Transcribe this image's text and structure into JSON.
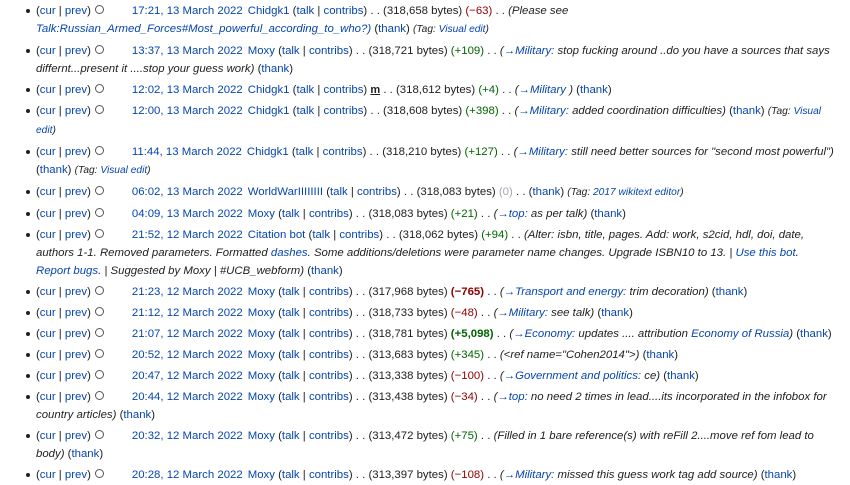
{
  "links": {
    "cur": "cur",
    "prev": "prev",
    "talk": "talk",
    "contribs": "contribs",
    "thank": "thank"
  },
  "entries": [
    {
      "date": "17:21, 13 March 2022",
      "user": "Chidgk1",
      "minor": "",
      "size": "(318,658 bytes)",
      "diff": "(−63)",
      "diff_class": "neg-small",
      "comment_pre": "(Please see",
      "comment_section": "",
      "comment_body": "",
      "comment_line2": "Talk:Russian_Armed_Forces#Most_powerful_according_to_who?)",
      "comment_post": "",
      "tags_label": "Tag:",
      "tags": "Visual edit"
    },
    {
      "date": "13:37, 13 March 2022",
      "user": "Moxy",
      "minor": "",
      "size": "(318,721 bytes)",
      "diff": "(+109)",
      "diff_class": "pos-small",
      "comment_pre": "(",
      "comment_section": "→Military:",
      "comment_body": "stop fucking around ..do you have a sources that says differnt...present it ....stop your guess work)",
      "comment_line2": "",
      "comment_post": "",
      "tags_label": "",
      "tags": ""
    },
    {
      "date": "12:02, 13 March 2022",
      "user": "Chidgk1",
      "minor": "m",
      "size": "(318,612 bytes)",
      "diff": "(+4)",
      "diff_class": "pos-small",
      "comment_pre": "(",
      "comment_section": "→Military",
      "comment_body": ")",
      "comment_line2": "",
      "comment_post": "",
      "tags_label": "",
      "tags": ""
    },
    {
      "date": "12:00, 13 March 2022",
      "user": "Chidgk1",
      "minor": "",
      "size": "(318,608 bytes)",
      "diff": "(+398)",
      "diff_class": "pos-small",
      "comment_pre": "(",
      "comment_section": "→Military:",
      "comment_body": "added coordination difficulties)",
      "comment_line2": "",
      "comment_post": "",
      "tags_label": "Tag:",
      "tags": "Visual edit"
    },
    {
      "date": "11:44, 13 March 2022",
      "user": "Chidgk1",
      "minor": "",
      "size": "(318,210 bytes)",
      "diff": "(+127)",
      "diff_class": "pos-small",
      "comment_pre": "(",
      "comment_section": "→Military:",
      "comment_body": "still need better sources for \"second most powerful\")",
      "comment_line2": "",
      "comment_post": "",
      "tags_label": "Tag:",
      "tags": "Visual edit"
    },
    {
      "date": "06:02, 13 March 2022",
      "user": "WorldWarIIIIIIII",
      "minor": "",
      "size": "(318,083 bytes)",
      "diff": "(0)",
      "diff_class": "zero",
      "comment_pre": "",
      "comment_section": "",
      "comment_body": "",
      "comment_line2": "",
      "comment_post": "",
      "tags_label": "Tag:",
      "tags": "2017 wikitext editor"
    },
    {
      "date": "04:09, 13 March 2022",
      "user": "Moxy",
      "minor": "",
      "size": "(318,083 bytes)",
      "diff": "(+21)",
      "diff_class": "pos-small",
      "comment_pre": "(",
      "comment_section": "→top:",
      "comment_body": "as per talk)",
      "comment_line2": "",
      "comment_post": "",
      "tags_label": "",
      "tags": ""
    },
    {
      "date": "21:52, 12 March 2022",
      "user": "Citation bot",
      "minor": "",
      "size": "(318,062 bytes)",
      "diff": "(+94)",
      "diff_class": "pos-small",
      "comment_pre": "(Alter: isbn, title, pages. Add: work, s2cid, hdl, doi, date, authors 1-1. Removed parameters. Formatted",
      "comment_section": "",
      "comment_body": "",
      "comment_line2": "",
      "comment_post": "",
      "tags_label": "",
      "tags": "",
      "link1": "dashes",
      "mid1": ". Some additions/deletions were parameter name changes. Upgrade ISBN10 to 13. |",
      "link2": "Use this bot",
      "mid2": ".",
      "link3": "Report bugs",
      "tail": ". | Suggested by Moxy | #UCB_webform)"
    },
    {
      "date": "21:23, 12 March 2022",
      "user": "Moxy",
      "minor": "",
      "size": "(317,968 bytes)",
      "diff": "(−765)",
      "diff_class": "neg",
      "comment_pre": "(",
      "comment_section": "→Transport and energy:",
      "comment_body": "trim decoration)",
      "comment_line2": "",
      "comment_post": "",
      "tags_label": "",
      "tags": ""
    },
    {
      "date": "21:12, 12 March 2022",
      "user": "Moxy",
      "minor": "",
      "size": "(318,733 bytes)",
      "diff": "(−48)",
      "diff_class": "neg-small",
      "comment_pre": "(",
      "comment_section": "→Military:",
      "comment_body": "see talk)",
      "comment_line2": "",
      "comment_post": "",
      "tags_label": "",
      "tags": ""
    },
    {
      "date": "21:07, 12 March 2022",
      "user": "Moxy",
      "minor": "",
      "size": "(318,781 bytes)",
      "diff": "(+5,098)",
      "diff_class": "pos",
      "comment_pre": "(",
      "comment_section": "→Economy:",
      "comment_body": "updates .... attribution",
      "comment_line2": "",
      "comment_post": "",
      "tags_label": "",
      "tags": "",
      "econ_link": "Economy of Russia",
      "econ_tail": ")"
    },
    {
      "date": "20:52, 12 March 2022",
      "user": "Moxy",
      "minor": "",
      "size": "(313,683 bytes)",
      "diff": "(+345)",
      "diff_class": "pos-small",
      "comment_pre": "(<ref name=\"Cohen2014\">)",
      "comment_section": "",
      "comment_body": "",
      "comment_line2": "",
      "comment_post": "",
      "tags_label": "",
      "tags": ""
    },
    {
      "date": "20:47, 12 March 2022",
      "user": "Moxy",
      "minor": "",
      "size": "(313,338 bytes)",
      "diff": "(−100)",
      "diff_class": "neg-small",
      "comment_pre": "(",
      "comment_section": "→Government and politics:",
      "comment_body": "ce)",
      "comment_line2": "",
      "comment_post": "",
      "tags_label": "",
      "tags": ""
    },
    {
      "date": "20:44, 12 March 2022",
      "user": "Moxy",
      "minor": "",
      "size": "(313,438 bytes)",
      "diff": "(−34)",
      "diff_class": "neg-small",
      "comment_pre": "(",
      "comment_section": "→top:",
      "comment_body": "no need 2 times in lead....its incorporated in the infobox for country articles)",
      "comment_line2": "",
      "comment_post": "",
      "tags_label": "",
      "tags": ""
    },
    {
      "date": "20:32, 12 March 2022",
      "user": "Moxy",
      "minor": "",
      "size": "(313,472 bytes)",
      "diff": "(+75)",
      "diff_class": "pos-small",
      "comment_pre": "(Filled in 1 bare reference(s) with reFill 2....move ref fom lead to body)",
      "comment_section": "",
      "comment_body": "",
      "comment_line2": "",
      "comment_post": "",
      "tags_label": "",
      "tags": ""
    },
    {
      "date": "20:28, 12 March 2022",
      "user": "Moxy",
      "minor": "",
      "size": "(313,397 bytes)",
      "diff": "(−108)",
      "diff_class": "neg-small",
      "comment_pre": "(",
      "comment_section": "→Military:",
      "comment_body": "missed this guess work tag add source)",
      "comment_line2": "",
      "comment_post": "",
      "tags_label": "",
      "tags": ""
    }
  ]
}
